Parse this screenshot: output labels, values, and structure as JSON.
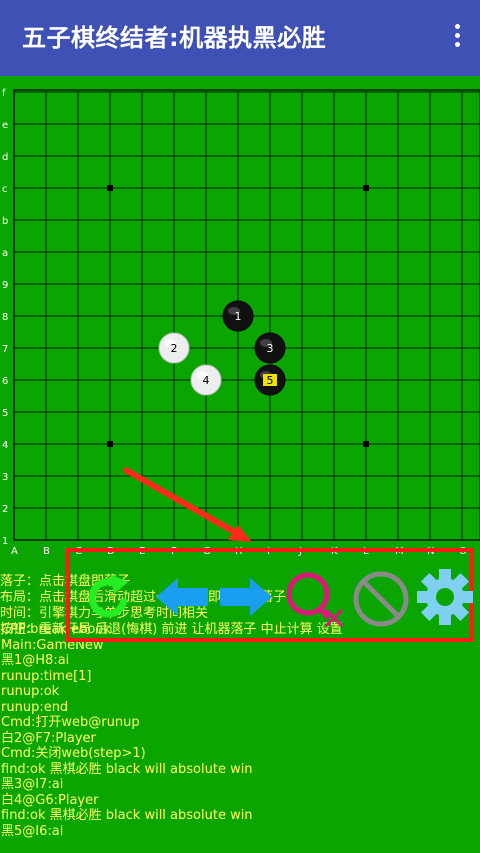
{
  "app": {
    "title": "五子棋终结者:机器执黑必胜",
    "menu_icon": "more-vert-icon"
  },
  "board": {
    "size": 15,
    "row_labels": [
      "f",
      "e",
      "d",
      "c",
      "b",
      "a",
      "9",
      "8",
      "7",
      "6",
      "5",
      "4",
      "3",
      "2",
      "1"
    ],
    "col_labels": [
      "A",
      "B",
      "C",
      "D",
      "E",
      "F",
      "G",
      "H",
      "I",
      "J",
      "K",
      "L",
      "M",
      "N",
      "O"
    ],
    "star_points": [
      "D12",
      "L12",
      "D4",
      "L4"
    ],
    "stones": [
      {
        "num": "1",
        "color": "black",
        "point": "H8"
      },
      {
        "num": "2",
        "color": "white",
        "point": "F7"
      },
      {
        "num": "3",
        "color": "black",
        "point": "I7"
      },
      {
        "num": "4",
        "color": "white",
        "point": "G6"
      },
      {
        "num": "5",
        "color": "black",
        "point": "I6",
        "last": true
      }
    ],
    "colors": {
      "board": "#0aa500",
      "grid": "#000000",
      "label": "#ffffff",
      "last_marker": "#f0e000"
    }
  },
  "help_lines": [
    "落子：点击棋盘即落子",
    "布局：点击棋盘后滑动超过一格距离即为布局落子",
    "时间：引擎棋力与单步思考时间相关",
    "按钮：重新开局  后退(悔棋)  前进  让机器落子  中止计算  设置"
  ],
  "toolbar": {
    "icons": [
      "restart-icon",
      "back-arrow-icon",
      "forward-arrow-icon",
      "machine-move-icon",
      "stop-icon",
      "settings-icon"
    ],
    "colors": {
      "restart": "#22ee22",
      "arrows": "#1a9ef0",
      "machine": "#e0177a",
      "stop": "#8a8a8a",
      "settings": "#7ecff0",
      "highlight": "#ff1a1a"
    }
  },
  "log_lines": [
    "CPP:break ebook",
    "Main:GameNew",
    "黑1@H8:ai",
    "runup:time[1]",
    "runup:ok",
    "runup:end",
    "Cmd:打开web@runup",
    "白2@F7:Player",
    "Cmd:关闭web(step>1)",
    "find:ok 黑棋必胜 black will absolute win",
    "黑3@I7:ai",
    "白4@G6:Player",
    "find:ok 黑棋必胜 black will absolute win",
    "黑5@I6:ai"
  ]
}
